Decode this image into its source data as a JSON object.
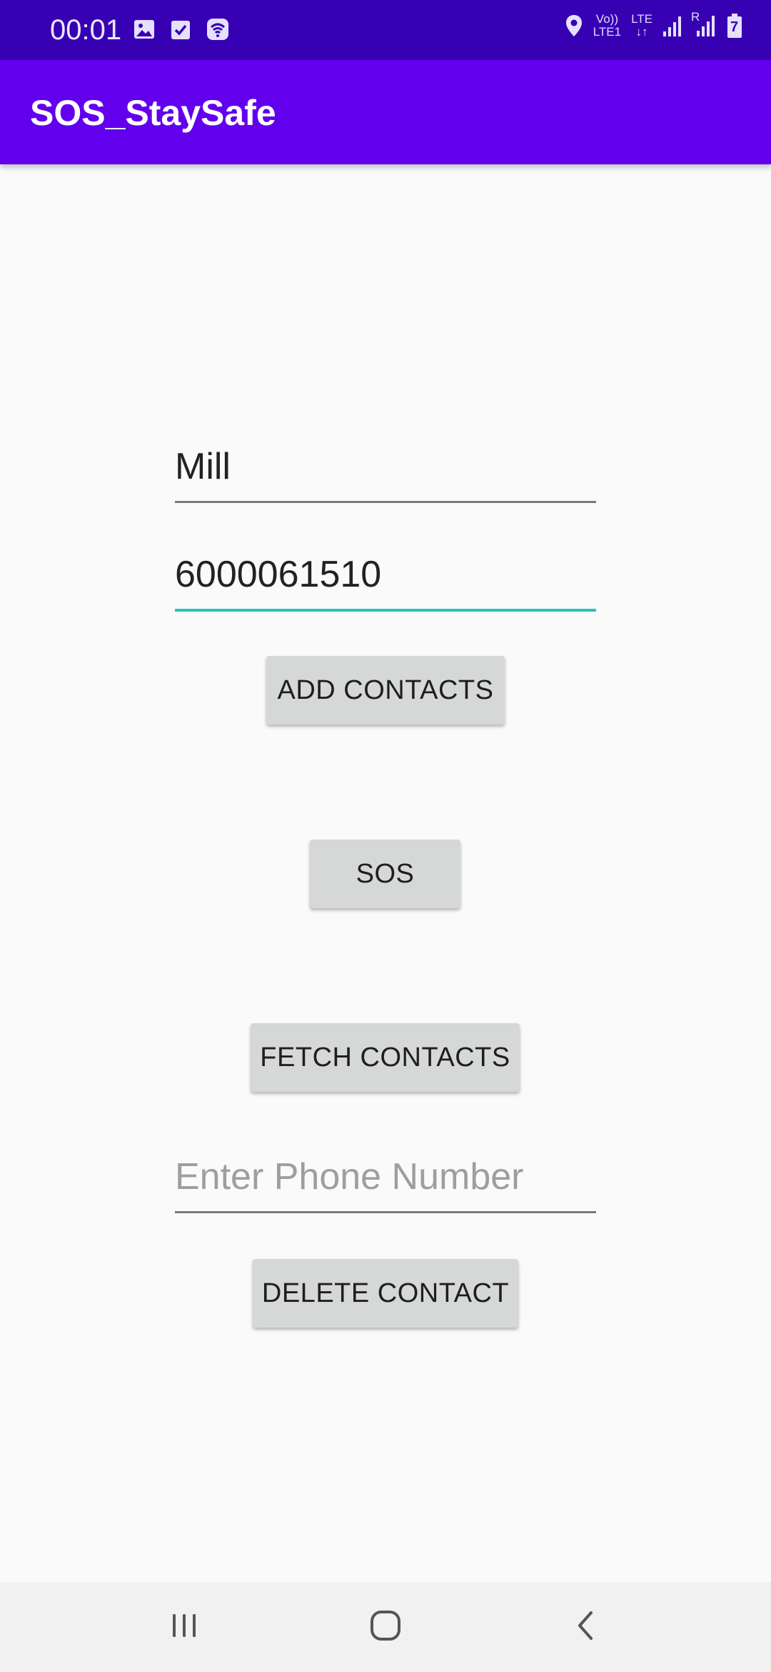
{
  "status_bar": {
    "time": "00:01",
    "left_icons": [
      "image-icon",
      "checkbox-icon",
      "wifi-calling-icon"
    ],
    "right_icons": [
      "location-icon",
      "volte-icon",
      "lte-icon",
      "signal-icon",
      "roaming-signal-icon",
      "battery-icon"
    ],
    "volte_label_top": "Vo))",
    "volte_label_bottom": "LTE1",
    "lte_label": "LTE",
    "roaming_label": "R",
    "battery_level": "7"
  },
  "app_bar": {
    "title": "SOS_StaySafe"
  },
  "form": {
    "name_value": "Mill",
    "phone_value": "6000061510",
    "add_contacts_label": "ADD CONTACTS",
    "sos_label": "SOS",
    "fetch_contacts_label": "FETCH CONTACTS",
    "delete_phone_placeholder": "Enter Phone Number",
    "delete_phone_value": "",
    "delete_contact_label": "DELETE CONTACT"
  },
  "nav_bar": {
    "icons": [
      "recents-icon",
      "home-icon",
      "back-icon"
    ]
  },
  "colors": {
    "status_bar": "#3700b3",
    "app_bar": "#6200ee",
    "focus_underline": "#26c6b8",
    "button_bg": "#d6d7d7",
    "background": "#fafafa"
  }
}
